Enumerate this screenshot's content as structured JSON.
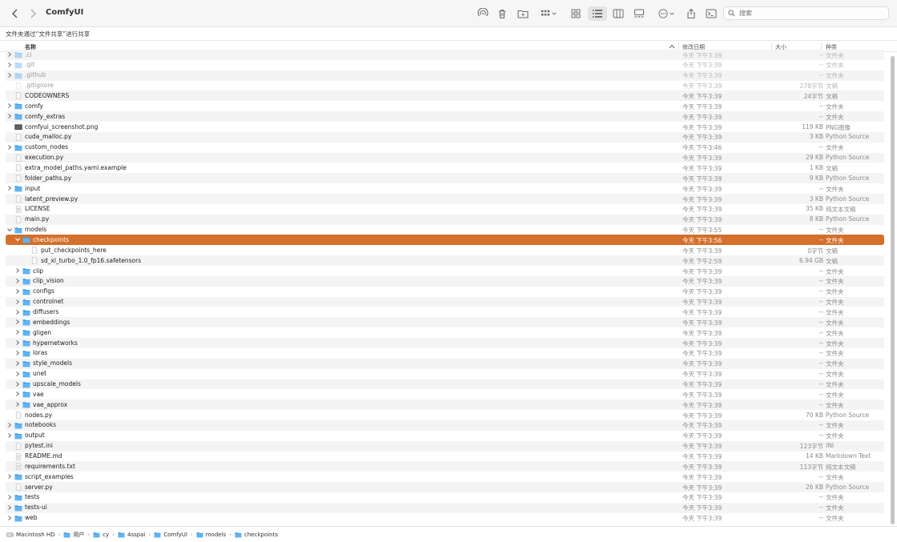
{
  "window": {
    "title": "ComfyUI"
  },
  "toolbar": {
    "search_placeholder": "搜索",
    "icons": [
      "back-icon",
      "forward-icon",
      "airdrop-icon",
      "trash-icon",
      "new-folder-icon",
      "group-icon",
      "icon-view-icon",
      "list-view-icon",
      "column-view-icon",
      "gallery-view-icon",
      "more-actions-icon",
      "share-icon",
      "terminal-icon",
      "search-icon"
    ]
  },
  "share_bar": {
    "text": "文件夹通过“文件共享”进行共享"
  },
  "columns": {
    "name": "名称",
    "date": "修改日期",
    "size": "大小",
    "kind": "种类"
  },
  "colors": {
    "selection": "#d4702c",
    "folder": "#3f9de6",
    "stripe": "#f4f4f4"
  },
  "rows": [
    {
      "name": ".ci",
      "date": "今天 下午3:39",
      "size": "--",
      "kind": "文件夹",
      "type": "folder",
      "level": 0,
      "disclosure": "closed",
      "faded": true
    },
    {
      "name": ".git",
      "date": "今天 下午3:39",
      "size": "--",
      "kind": "文件夹",
      "type": "folder",
      "level": 0,
      "disclosure": "closed",
      "faded": true
    },
    {
      "name": ".github",
      "date": "今天 下午3:39",
      "size": "--",
      "kind": "文件夹",
      "type": "folder",
      "level": 0,
      "disclosure": "closed",
      "faded": true
    },
    {
      "name": ".gitignore",
      "date": "今天 下午3:39",
      "size": "278字节",
      "kind": "文稿",
      "type": "file",
      "level": 0,
      "faded": true
    },
    {
      "name": "CODEOWNERS",
      "date": "今天 下午3:39",
      "size": "24字节",
      "kind": "文稿",
      "type": "file",
      "level": 0
    },
    {
      "name": "comfy",
      "date": "今天 下午3:39",
      "size": "--",
      "kind": "文件夹",
      "type": "folder",
      "level": 0,
      "disclosure": "closed"
    },
    {
      "name": "comfy_extras",
      "date": "今天 下午3:39",
      "size": "--",
      "kind": "文件夹",
      "type": "folder",
      "level": 0,
      "disclosure": "closed"
    },
    {
      "name": "comfyui_screenshot.png",
      "date": "今天 下午3:39",
      "size": "119 KB",
      "kind": "PNG图像",
      "type": "image",
      "level": 0
    },
    {
      "name": "cuda_malloc.py",
      "date": "今天 下午3:39",
      "size": "3 KB",
      "kind": "Python Source",
      "type": "file",
      "level": 0
    },
    {
      "name": "custom_nodes",
      "date": "今天 下午3:46",
      "size": "--",
      "kind": "文件夹",
      "type": "folder",
      "level": 0,
      "disclosure": "closed"
    },
    {
      "name": "execution.py",
      "date": "今天 下午3:39",
      "size": "29 KB",
      "kind": "Python Source",
      "type": "file",
      "level": 0
    },
    {
      "name": "extra_model_paths.yaml.example",
      "date": "今天 下午3:39",
      "size": "1 KB",
      "kind": "文稿",
      "type": "file",
      "level": 0
    },
    {
      "name": "folder_paths.py",
      "date": "今天 下午3:39",
      "size": "9 KB",
      "kind": "Python Source",
      "type": "file",
      "level": 0
    },
    {
      "name": "input",
      "date": "今天 下午3:39",
      "size": "--",
      "kind": "文件夹",
      "type": "folder",
      "level": 0,
      "disclosure": "closed"
    },
    {
      "name": "latent_preview.py",
      "date": "今天 下午3:39",
      "size": "3 KB",
      "kind": "Python Source",
      "type": "file",
      "level": 0
    },
    {
      "name": "LICENSE",
      "date": "今天 下午3:39",
      "size": "35 KB",
      "kind": "纯文本文稿",
      "type": "text",
      "level": 0
    },
    {
      "name": "main.py",
      "date": "今天 下午3:39",
      "size": "8 KB",
      "kind": "Python Source",
      "type": "file",
      "level": 0
    },
    {
      "name": "models",
      "date": "今天 下午3:55",
      "size": "--",
      "kind": "文件夹",
      "type": "folder",
      "level": 0,
      "disclosure": "open"
    },
    {
      "name": "checkpoints",
      "date": "今天 下午3:56",
      "size": "--",
      "kind": "文件夹",
      "type": "folder",
      "level": 1,
      "disclosure": "open",
      "selected": true
    },
    {
      "name": "put_checkpoints_here",
      "date": "今天 下午3:39",
      "size": "0字节",
      "kind": "文稿",
      "type": "file",
      "level": 2
    },
    {
      "name": "sd_xl_turbo_1.0_fp16.safetensors",
      "date": "今天 下午2:59",
      "size": "6.94 GB",
      "kind": "文稿",
      "type": "file",
      "level": 2
    },
    {
      "name": "clip",
      "date": "今天 下午3:39",
      "size": "--",
      "kind": "文件夹",
      "type": "folder",
      "level": 1,
      "disclosure": "closed"
    },
    {
      "name": "clip_vision",
      "date": "今天 下午3:39",
      "size": "--",
      "kind": "文件夹",
      "type": "folder",
      "level": 1,
      "disclosure": "closed"
    },
    {
      "name": "configs",
      "date": "今天 下午3:39",
      "size": "--",
      "kind": "文件夹",
      "type": "folder",
      "level": 1,
      "disclosure": "closed"
    },
    {
      "name": "controlnet",
      "date": "今天 下午3:39",
      "size": "--",
      "kind": "文件夹",
      "type": "folder",
      "level": 1,
      "disclosure": "closed"
    },
    {
      "name": "diffusers",
      "date": "今天 下午3:39",
      "size": "--",
      "kind": "文件夹",
      "type": "folder",
      "level": 1,
      "disclosure": "closed"
    },
    {
      "name": "embeddings",
      "date": "今天 下午3:39",
      "size": "--",
      "kind": "文件夹",
      "type": "folder",
      "level": 1,
      "disclosure": "closed"
    },
    {
      "name": "gligen",
      "date": "今天 下午3:39",
      "size": "--",
      "kind": "文件夹",
      "type": "folder",
      "level": 1,
      "disclosure": "closed"
    },
    {
      "name": "hypernetworks",
      "date": "今天 下午3:39",
      "size": "--",
      "kind": "文件夹",
      "type": "folder",
      "level": 1,
      "disclosure": "closed"
    },
    {
      "name": "loras",
      "date": "今天 下午3:39",
      "size": "--",
      "kind": "文件夹",
      "type": "folder",
      "level": 1,
      "disclosure": "closed"
    },
    {
      "name": "style_models",
      "date": "今天 下午3:39",
      "size": "--",
      "kind": "文件夹",
      "type": "folder",
      "level": 1,
      "disclosure": "closed"
    },
    {
      "name": "unet",
      "date": "今天 下午3:39",
      "size": "--",
      "kind": "文件夹",
      "type": "folder",
      "level": 1,
      "disclosure": "closed"
    },
    {
      "name": "upscale_models",
      "date": "今天 下午3:39",
      "size": "--",
      "kind": "文件夹",
      "type": "folder",
      "level": 1,
      "disclosure": "closed"
    },
    {
      "name": "vae",
      "date": "今天 下午3:39",
      "size": "--",
      "kind": "文件夹",
      "type": "folder",
      "level": 1,
      "disclosure": "closed"
    },
    {
      "name": "vae_approx",
      "date": "今天 下午3:39",
      "size": "--",
      "kind": "文件夹",
      "type": "folder",
      "level": 1,
      "disclosure": "closed"
    },
    {
      "name": "nodes.py",
      "date": "今天 下午3:39",
      "size": "70 KB",
      "kind": "Python Source",
      "type": "file",
      "level": 0
    },
    {
      "name": "notebooks",
      "date": "今天 下午3:39",
      "size": "--",
      "kind": "文件夹",
      "type": "folder",
      "level": 0,
      "disclosure": "closed"
    },
    {
      "name": "output",
      "date": "今天 下午3:39",
      "size": "--",
      "kind": "文件夹",
      "type": "folder",
      "level": 0,
      "disclosure": "closed"
    },
    {
      "name": "pytest.ini",
      "date": "今天 下午3:39",
      "size": "123字节",
      "kind": "INI",
      "type": "file",
      "level": 0
    },
    {
      "name": "README.md",
      "date": "今天 下午3:39",
      "size": "14 KB",
      "kind": "Markdown Text",
      "type": "text",
      "level": 0
    },
    {
      "name": "requirements.txt",
      "date": "今天 下午3:39",
      "size": "113字节",
      "kind": "纯文本文稿",
      "type": "text",
      "level": 0
    },
    {
      "name": "script_examples",
      "date": "今天 下午3:39",
      "size": "--",
      "kind": "文件夹",
      "type": "folder",
      "level": 0,
      "disclosure": "closed"
    },
    {
      "name": "server.py",
      "date": "今天 下午3:39",
      "size": "26 KB",
      "kind": "Python Source",
      "type": "file",
      "level": 0
    },
    {
      "name": "tests",
      "date": "今天 下午3:39",
      "size": "--",
      "kind": "文件夹",
      "type": "folder",
      "level": 0,
      "disclosure": "closed"
    },
    {
      "name": "tests-ui",
      "date": "今天 下午3:39",
      "size": "--",
      "kind": "文件夹",
      "type": "folder",
      "level": 0,
      "disclosure": "closed"
    },
    {
      "name": "web",
      "date": "今天 下午3:39",
      "size": "--",
      "kind": "文件夹",
      "type": "folder",
      "level": 0,
      "disclosure": "closed"
    }
  ],
  "path_bar": [
    {
      "label": "Macintosh HD",
      "icon": "disk-icon"
    },
    {
      "label": "用户",
      "icon": "folder-icon"
    },
    {
      "label": "cy",
      "icon": "folder-icon"
    },
    {
      "label": "4sspai",
      "icon": "folder-icon"
    },
    {
      "label": "ComfyUI",
      "icon": "folder-icon"
    },
    {
      "label": "models",
      "icon": "folder-icon"
    },
    {
      "label": "checkpoints",
      "icon": "folder-icon"
    }
  ]
}
